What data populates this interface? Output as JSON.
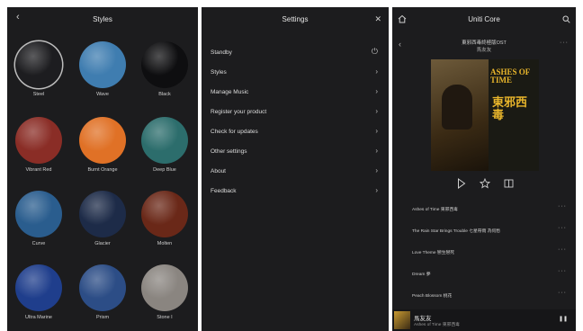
{
  "styles_screen": {
    "title": "Styles",
    "back_glyph": "‹",
    "items": [
      {
        "label": "Steel",
        "color": "#1d1d20"
      },
      {
        "label": "Wave",
        "color": "#3f7db0"
      },
      {
        "label": "Black",
        "color": "#0e0e10"
      },
      {
        "label": "Vibrant Red",
        "color": "#8a2d26"
      },
      {
        "label": "Burnt Orange",
        "color": "#e07126"
      },
      {
        "label": "Deep Blue",
        "color": "#2c6d6c"
      },
      {
        "label": "Curve",
        "color": "#2a5d8e"
      },
      {
        "label": "Glacier",
        "color": "#1d2b48"
      },
      {
        "label": "Molten",
        "color": "#6a2818"
      },
      {
        "label": "Ultra Marine",
        "color": "#1f3e8c"
      },
      {
        "label": "Prism",
        "color": "#2c4d86"
      },
      {
        "label": "Stone I",
        "color": "#8a8580"
      }
    ]
  },
  "settings_screen": {
    "title": "Settings",
    "close_glyph": "✕",
    "rows": [
      {
        "label": "Standby",
        "icon": "power-icon",
        "glyph": "⏻"
      },
      {
        "label": "Styles",
        "glyph": "›"
      },
      {
        "label": "Manage Music",
        "glyph": "›"
      },
      {
        "label": "Register your product",
        "glyph": "›"
      },
      {
        "label": "Check for updates",
        "glyph": "›"
      },
      {
        "label": "Other settings",
        "glyph": "›"
      },
      {
        "label": "About",
        "glyph": "›"
      },
      {
        "label": "Feedback",
        "glyph": "›"
      }
    ]
  },
  "player_screen": {
    "title": "Uniti Core",
    "album_subtitle_line1": "東邪西毒終極版OST",
    "album_subtitle_line2": "馬友友",
    "cover_text_1": "ASHES OF TIME",
    "cover_text_2": "東邪西毒",
    "more_glyph": "···",
    "tracks": [
      {
        "title": "Ashes of Time 東邪西毒"
      },
      {
        "title": "The Rain Star Brings Trouble 七星帶雨 為何愁"
      },
      {
        "title": "Love Theme 戀生戀死"
      },
      {
        "title": "Dream 夢"
      },
      {
        "title": "Peach Blossom 桃花"
      }
    ],
    "now_playing": {
      "title": "馬友友",
      "subtitle": "Ashes of Time 東邪西毒",
      "pause_glyph": "❚❚"
    }
  }
}
